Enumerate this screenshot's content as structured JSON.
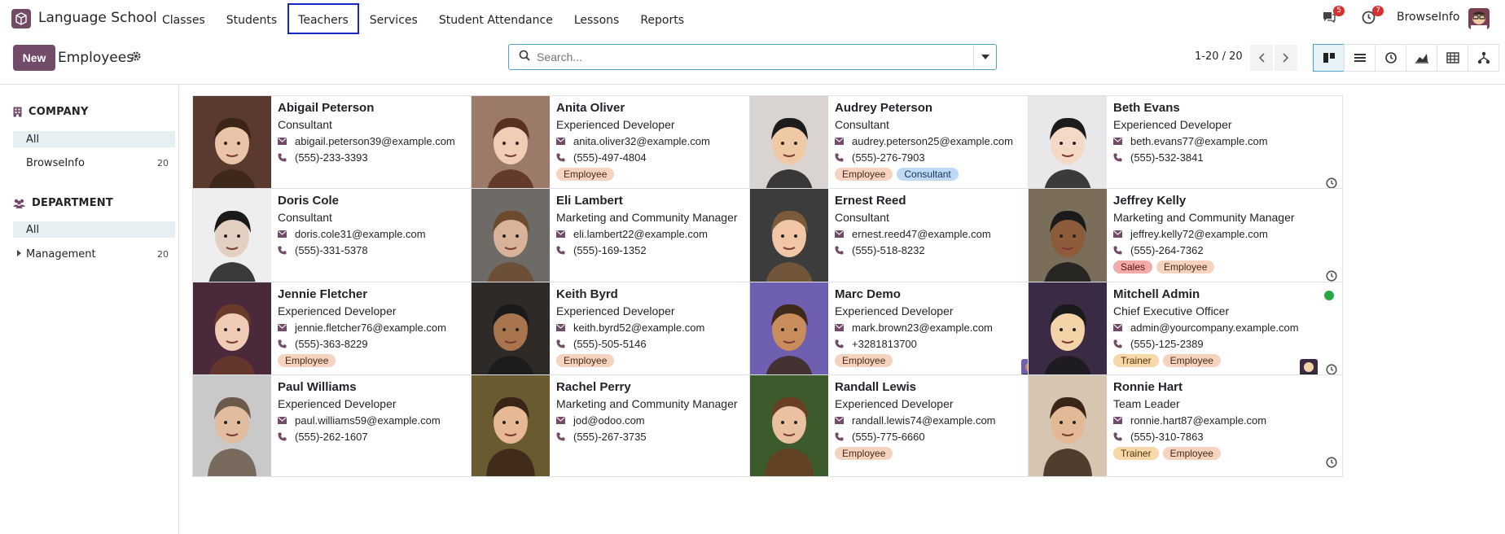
{
  "navbar": {
    "app_name": "Language School",
    "menu": [
      "Classes",
      "Students",
      "Teachers",
      "Services",
      "Student Attendance",
      "Lessons",
      "Reports"
    ],
    "active_menu_index": 2,
    "messages_count": "5",
    "activities_count": "7",
    "company": "BrowseInfo"
  },
  "control": {
    "new_label": "New",
    "title": "Employees",
    "search_placeholder": "Search...",
    "pager": "1-20 / 20",
    "views": [
      "kanban-icon",
      "list-icon",
      "activity-icon",
      "graph-icon",
      "pivot-icon",
      "hierarchy-icon"
    ]
  },
  "sidebar": {
    "company_header": "COMPANY",
    "company_items": [
      {
        "label": "All",
        "count": ""
      },
      {
        "label": "BrowseInfo",
        "count": "20"
      }
    ],
    "department_header": "DEPARTMENT",
    "department_items": [
      {
        "label": "All",
        "count": ""
      },
      {
        "label": "Management",
        "count": "20"
      }
    ]
  },
  "employees": [
    {
      "name": "Abigail Peterson",
      "job": "Consultant",
      "email": "abigail.peterson39@example.com",
      "phone": "(555)-233-3393",
      "tags": []
    },
    {
      "name": "Anita Oliver",
      "job": "Experienced Developer",
      "email": "anita.oliver32@example.com",
      "phone": "(555)-497-4804",
      "tags": [
        "Employee"
      ]
    },
    {
      "name": "Audrey Peterson",
      "job": "Consultant",
      "email": "audrey.peterson25@example.com",
      "phone": "(555)-276-7903",
      "tags": [
        "Employee",
        "Consultant"
      ]
    },
    {
      "name": "Beth Evans",
      "job": "Experienced Developer",
      "email": "beth.evans77@example.com",
      "phone": "(555)-532-3841",
      "tags": []
    },
    {
      "name": "Doris Cole",
      "job": "Consultant",
      "email": "doris.cole31@example.com",
      "phone": "(555)-331-5378",
      "tags": []
    },
    {
      "name": "Eli Lambert",
      "job": "Marketing and Community Manager",
      "email": "eli.lambert22@example.com",
      "phone": "(555)-169-1352",
      "tags": []
    },
    {
      "name": "Ernest Reed",
      "job": "Consultant",
      "email": "ernest.reed47@example.com",
      "phone": "(555)-518-8232",
      "tags": []
    },
    {
      "name": "Jeffrey Kelly",
      "job": "Marketing and Community Manager",
      "email": "jeffrey.kelly72@example.com",
      "phone": "(555)-264-7362",
      "tags": [
        "Sales",
        "Employee"
      ]
    },
    {
      "name": "Jennie Fletcher",
      "job": "Experienced Developer",
      "email": "jennie.fletcher76@example.com",
      "phone": "(555)-363-8229",
      "tags": [
        "Employee"
      ]
    },
    {
      "name": "Keith Byrd",
      "job": "Experienced Developer",
      "email": "keith.byrd52@example.com",
      "phone": "(555)-505-5146",
      "tags": [
        "Employee"
      ]
    },
    {
      "name": "Marc Demo",
      "job": "Experienced Developer",
      "email": "mark.brown23@example.com",
      "phone": "+3281813700",
      "tags": [
        "Employee"
      ],
      "status": "#b7860b"
    },
    {
      "name": "Mitchell Admin",
      "job": "Chief Executive Officer",
      "email": "admin@yourcompany.example.com",
      "phone": "(555)-125-2389",
      "tags": [
        "Trainer",
        "Employee"
      ],
      "status": "#28a745"
    },
    {
      "name": "Paul Williams",
      "job": "Experienced Developer",
      "email": "paul.williams59@example.com",
      "phone": "(555)-262-1607",
      "tags": []
    },
    {
      "name": "Rachel Perry",
      "job": "Marketing and Community Manager",
      "email": "jod@odoo.com",
      "phone": "(555)-267-3735",
      "tags": []
    },
    {
      "name": "Randall Lewis",
      "job": "Experienced Developer",
      "email": "randall.lewis74@example.com",
      "phone": "(555)-775-6660",
      "tags": [
        "Employee"
      ]
    },
    {
      "name": "Ronnie Hart",
      "job": "Team Leader",
      "email": "ronnie.hart87@example.com",
      "phone": "(555)-310-7863",
      "tags": [
        "Trainer",
        "Employee"
      ]
    }
  ],
  "tag_colors": {
    "Employee": {
      "bg": "#f6d3c0",
      "fg": "#4a2a17"
    },
    "Consultant": {
      "bg": "#bfd9f5",
      "fg": "#15325a"
    },
    "Sales": {
      "bg": "#f4a9a9",
      "fg": "#4f1212"
    },
    "Trainer": {
      "bg": "#f8d7a8",
      "fg": "#4d3210"
    }
  },
  "colors": {
    "brand": "#714B67",
    "accent": "#4ba5c7",
    "active_menu_border": "#1a25c8"
  }
}
